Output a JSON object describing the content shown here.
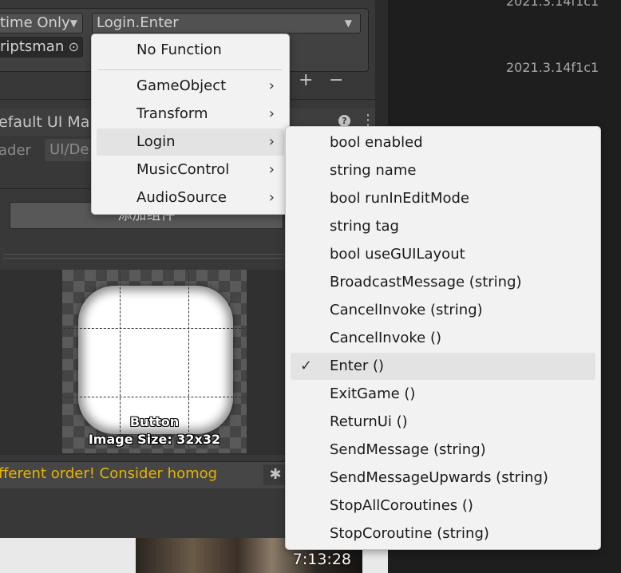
{
  "background": {
    "versions": [
      "2021.3.14f1c1",
      "2021.3.14f1c1"
    ],
    "video_time": "7:13:28"
  },
  "inspector": {
    "runtime_dropdown": "time Only",
    "function_dropdown": "Login.Enter",
    "object_field": "riptsman",
    "material_title": "efault UI Ma",
    "shader_label": "ader",
    "shader_value": "UI/De",
    "add_component": "添加组件",
    "preview_label": "Button",
    "preview_size": "Image Size: 32x32",
    "warning": "fferent order! Consider homog"
  },
  "menu_main": {
    "no_function": "No Function",
    "items": [
      {
        "label": "GameObject"
      },
      {
        "label": "Transform"
      },
      {
        "label": "Login"
      },
      {
        "label": "MusicControl"
      },
      {
        "label": "AudioSource"
      }
    ]
  },
  "menu_sub": {
    "items": [
      {
        "label": "bool enabled"
      },
      {
        "label": "string name"
      },
      {
        "label": "bool runInEditMode"
      },
      {
        "label": "string tag"
      },
      {
        "label": "bool useGUILayout"
      },
      {
        "label": "BroadcastMessage (string)"
      },
      {
        "label": "CancelInvoke (string)"
      },
      {
        "label": "CancelInvoke ()"
      },
      {
        "label": "Enter ()"
      },
      {
        "label": "ExitGame ()"
      },
      {
        "label": "ReturnUi ()"
      },
      {
        "label": "SendMessage (string)"
      },
      {
        "label": "SendMessageUpwards (string)"
      },
      {
        "label": "StopAllCoroutines ()"
      },
      {
        "label": "StopCoroutine (string)"
      }
    ]
  }
}
